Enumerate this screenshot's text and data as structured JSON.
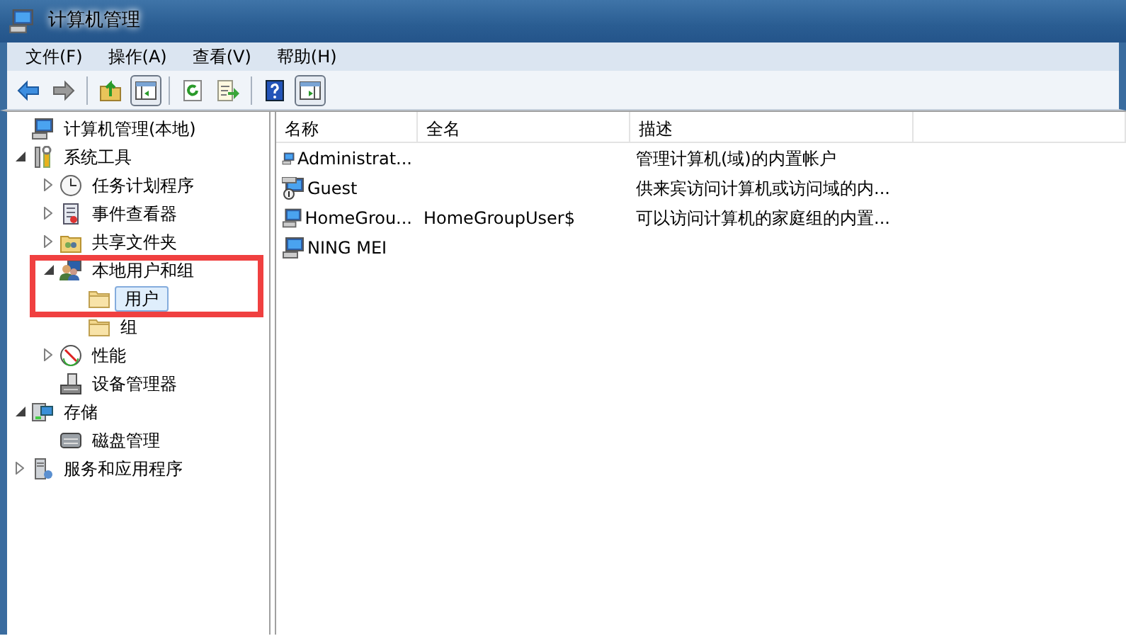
{
  "window": {
    "title": "计算机管理"
  },
  "menu": [
    "文件(F)",
    "操作(A)",
    "查看(V)",
    "帮助(H)"
  ],
  "toolbar": [
    {
      "kind": "back",
      "pressed": false
    },
    {
      "kind": "forward",
      "pressed": false
    },
    {
      "kind": "sep"
    },
    {
      "kind": "up",
      "pressed": false
    },
    {
      "kind": "tree",
      "pressed": true
    },
    {
      "kind": "sep"
    },
    {
      "kind": "refresh",
      "pressed": false
    },
    {
      "kind": "export",
      "pressed": false
    },
    {
      "kind": "sep"
    },
    {
      "kind": "help",
      "pressed": false
    },
    {
      "kind": "pane",
      "pressed": true
    }
  ],
  "tree": [
    {
      "label": "计算机管理(本地)",
      "kind": "computer",
      "selected": false,
      "children": [
        {
          "label": "系统工具",
          "kind": "tools",
          "expanded": true,
          "selected": false,
          "children": [
            {
              "label": "任务计划程序",
              "kind": "clock",
              "expanded": false,
              "selected": false
            },
            {
              "label": "事件查看器",
              "kind": "log",
              "expanded": false,
              "selected": false
            },
            {
              "label": "共享文件夹",
              "kind": "share",
              "expanded": false,
              "selected": false
            },
            {
              "label": "本地用户和组",
              "kind": "users",
              "expanded": true,
              "selected": false,
              "highlighted": true,
              "children": [
                {
                  "label": "用户",
                  "kind": "folder",
                  "selected": true
                },
                {
                  "label": "组",
                  "kind": "folder",
                  "selected": false
                }
              ]
            },
            {
              "label": "性能",
              "kind": "perf",
              "expanded": false,
              "selected": false
            },
            {
              "label": "设备管理器",
              "kind": "device",
              "selected": false
            }
          ]
        },
        {
          "label": "存储",
          "kind": "storage",
          "expanded": true,
          "selected": false,
          "children": [
            {
              "label": "磁盘管理",
              "kind": "disk",
              "selected": false
            }
          ]
        },
        {
          "label": "服务和应用程序",
          "kind": "services",
          "expanded": false,
          "selected": false
        }
      ]
    }
  ],
  "table": {
    "columns": [
      "名称",
      "全名",
      "描述"
    ],
    "rows": [
      {
        "kind": "user",
        "cells": [
          "Administrat...",
          "",
          "管理计算机(域)的内置帐户"
        ]
      },
      {
        "kind": "guest",
        "cells": [
          "Guest",
          "",
          "供来宾访问计算机或访问域的内..."
        ]
      },
      {
        "kind": "user",
        "cells": [
          "HomeGrou...",
          "HomeGroupUser$",
          "可以访问计算机的家庭组的内置..."
        ]
      },
      {
        "kind": "user",
        "cells": [
          "NING MEI",
          "",
          ""
        ]
      }
    ]
  }
}
